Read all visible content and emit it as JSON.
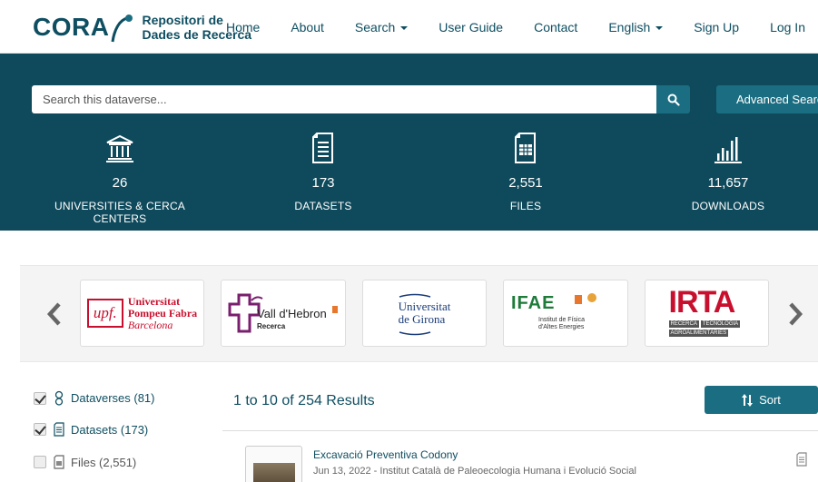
{
  "brand": {
    "wordmark": "CORA",
    "subtitle_line1": "Repositori de",
    "subtitle_line2": "Dades de Recerca"
  },
  "nav": {
    "items": [
      {
        "label": "Home"
      },
      {
        "label": "About"
      },
      {
        "label": "Search",
        "dropdown": true
      },
      {
        "label": "User Guide"
      },
      {
        "label": "Contact"
      },
      {
        "label": "English",
        "dropdown": true
      },
      {
        "label": "Sign Up"
      },
      {
        "label": "Log In"
      }
    ]
  },
  "search": {
    "placeholder": "Search this dataverse...",
    "advanced_label": "Advanced Search"
  },
  "stats": [
    {
      "icon": "university-icon",
      "value": "26",
      "label": "UNIVERSITIES & CERCA CENTERS"
    },
    {
      "icon": "dataset-document-icon",
      "value": "173",
      "label": "DATASETS"
    },
    {
      "icon": "file-table-icon",
      "value": "2,551",
      "label": "FILES"
    },
    {
      "icon": "bar-chart-icon",
      "value": "11,657",
      "label": "DOWNLOADS"
    }
  ],
  "carousel": {
    "logos": [
      {
        "name": "upf",
        "line1": "upf.",
        "line2": "Universitat",
        "line3": "Pompeu Fabra",
        "line4": "Barcelona"
      },
      {
        "name": "vall-dhebron",
        "line1": "Vall d'Hebron",
        "line2": "Recerca"
      },
      {
        "name": "udg",
        "line1": "Universitat",
        "line2": "de Girona"
      },
      {
        "name": "ifae",
        "line1": "IFAE",
        "line2": "Institut de Física",
        "line3": "d'Altes Energies"
      },
      {
        "name": "irta",
        "line1": "IRTA",
        "line2": "RECERCA",
        "line3": "TECNOLOGIA",
        "line4": "AGROALIMENTÀRIES"
      }
    ]
  },
  "facets": [
    {
      "label": "Dataverses (81)",
      "checked": true,
      "icon": "dataverse-icon"
    },
    {
      "label": "Datasets (173)",
      "checked": true,
      "icon": "dataset-icon"
    },
    {
      "label": "Files (2,551)",
      "checked": false,
      "icon": "file-icon"
    }
  ],
  "results": {
    "summary": "1 to 10 of 254 Results",
    "sort_label": "Sort",
    "items": [
      {
        "title": "Excavació Preventiva Codony",
        "meta": "Jun 13, 2022 - Institut Català de Paleoecologia Humana i Evolució Social"
      }
    ]
  },
  "colors": {
    "brand": "#0e4e61",
    "hero": "#0f4a5c",
    "button": "#1b6e82"
  }
}
